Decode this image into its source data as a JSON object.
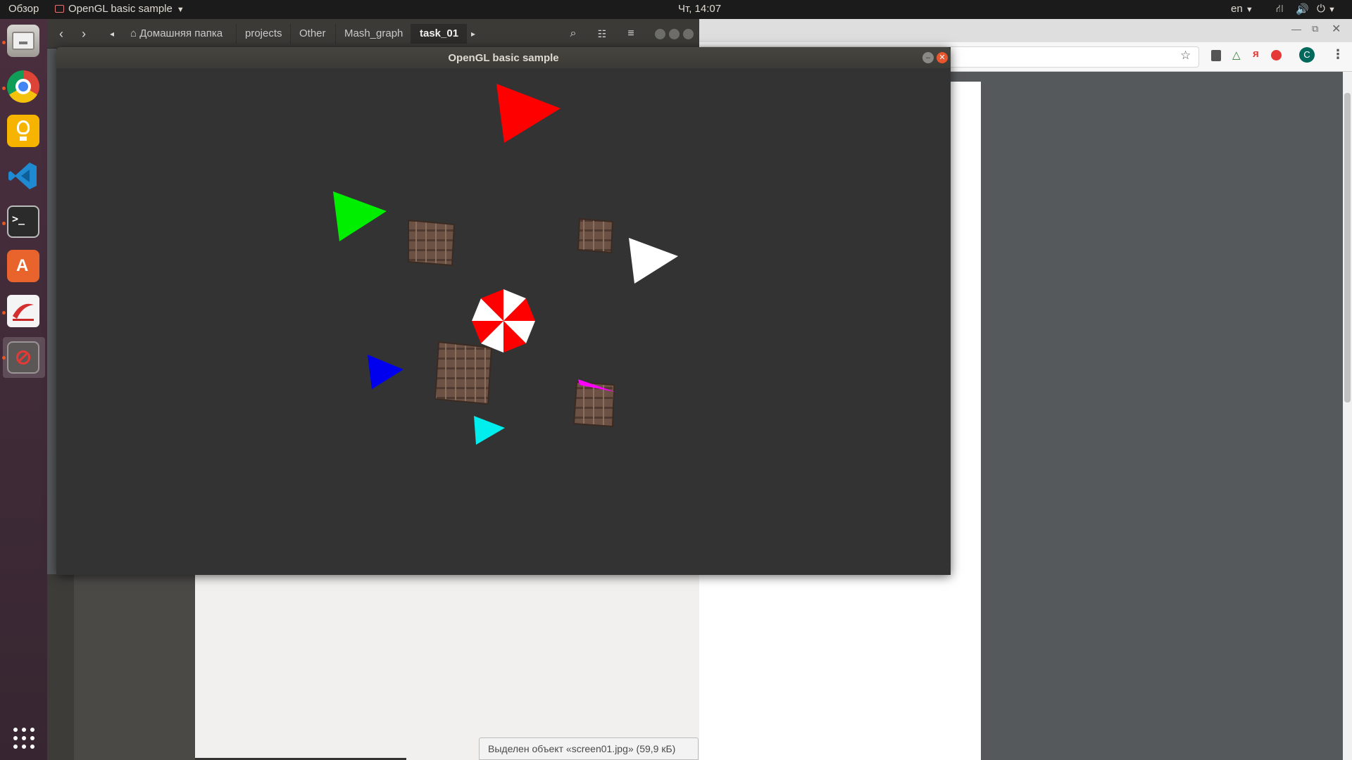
{
  "top_bar": {
    "activities": "Обзор",
    "app_menu": "OpenGL basic sample",
    "clock": "Чт, 14:07",
    "language": "en"
  },
  "dock": {
    "items": [
      {
        "name": "files",
        "running": true
      },
      {
        "name": "chrome",
        "running": true
      },
      {
        "name": "idea",
        "running": false
      },
      {
        "name": "vscode",
        "running": false
      },
      {
        "name": "terminal",
        "running": true
      },
      {
        "name": "software-center",
        "running": false
      },
      {
        "name": "document-viewer",
        "running": true
      },
      {
        "name": "opengl-app",
        "running": true
      }
    ]
  },
  "files": {
    "breadcrumbs": [
      "Домашняя папка",
      "projects",
      "Other",
      "Mash_graph",
      "task_01"
    ],
    "active_crumb": "task_01"
  },
  "chrome": {
    "profile_initial": "C",
    "ya_icon": "я"
  },
  "gl_window": {
    "title": "OpenGL basic sample"
  },
  "status": {
    "message": "Выделен объект «screen01.jpg»  (59,9 кБ)"
  }
}
